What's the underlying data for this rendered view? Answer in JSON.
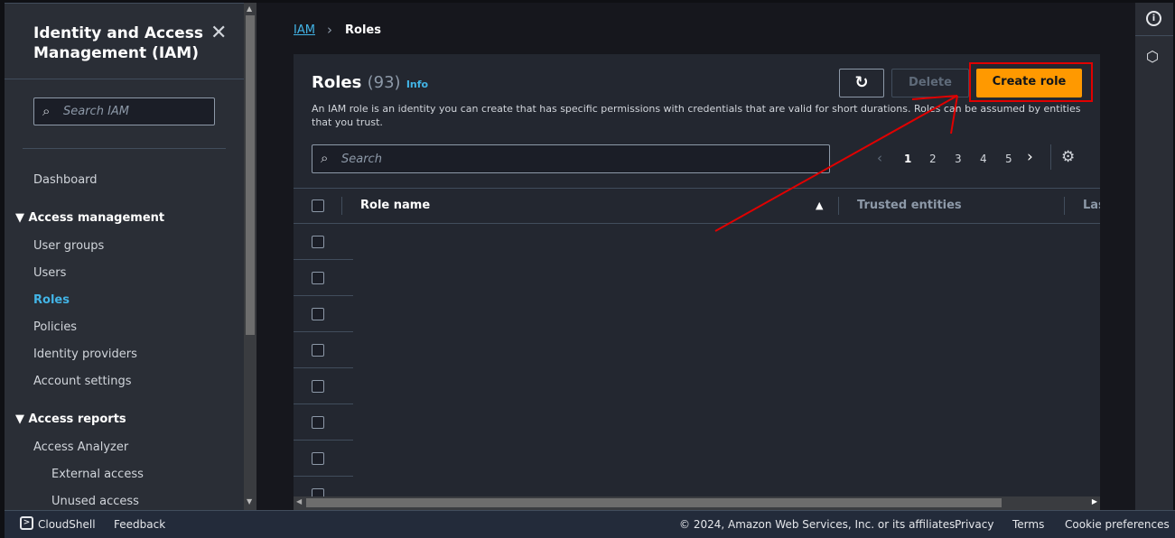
{
  "sidebar": {
    "title": "Identity and Access Management (IAM)",
    "search_placeholder": "Search IAM",
    "dashboard": "Dashboard",
    "access_management": "Access management",
    "am_items": [
      "User groups",
      "Users",
      "Roles",
      "Policies",
      "Identity providers",
      "Account settings"
    ],
    "access_reports": "Access reports",
    "ar_items": [
      "Access Analyzer",
      "External access",
      "Unused access"
    ]
  },
  "breadcrumb": {
    "root": "IAM",
    "current": "Roles"
  },
  "roles": {
    "title": "Roles",
    "count": "(93)",
    "info": "Info",
    "description": "An IAM role is an identity you can create that has specific permissions with credentials that are valid for short durations. Roles can be assumed by entities that you trust.",
    "delete": "Delete",
    "create": "Create role",
    "search_placeholder": "Search",
    "pages": [
      "1",
      "2",
      "3",
      "4",
      "5"
    ],
    "current_page": "1",
    "columns": [
      "Role name",
      "Trusted entities",
      "Las"
    ]
  },
  "footer": {
    "cloudshell": "CloudShell",
    "feedback": "Feedback",
    "copyright": "© 2024, Amazon Web Services, Inc. or its affiliates.",
    "privacy": "Privacy",
    "terms": "Terms",
    "cookies": "Cookie preferences"
  },
  "colors": {
    "accent": "#42b4e6",
    "primary": "#ff9900",
    "annotation": "#e00000"
  }
}
